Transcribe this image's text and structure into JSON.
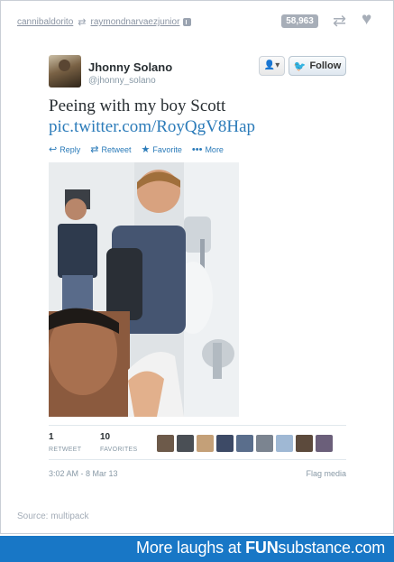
{
  "tumblr": {
    "reblogged_from": "cannibaldorito",
    "reblogged_via": "raymondnarvaezjunior",
    "note_count": "58,963",
    "icons": {
      "reblog_trail": "reblog-icon",
      "reblog": "reblog-icon",
      "like": "heart-icon"
    }
  },
  "tweet": {
    "display_name": "Jhonny Solano",
    "handle": "@jhonny_solano",
    "follow_label": "Follow",
    "text": "Peeing with my boy Scott",
    "link": "pic.twitter.com/RoyQgV8Hap",
    "actions": [
      {
        "label": "Reply",
        "icon": "reply-icon"
      },
      {
        "label": "Retweet",
        "icon": "retweet-icon"
      },
      {
        "label": "Favorite",
        "icon": "star-icon"
      },
      {
        "label": "More",
        "icon": "more-icon"
      }
    ],
    "stats": {
      "retweets": "1",
      "retweets_label": "RETWEET",
      "favorites": "10",
      "favorites_label": "FAVORITES"
    },
    "timestamp": "3:02 AM - 8 Mar 13",
    "flag_label": "Flag media"
  },
  "source": "Source: multipack",
  "banner": {
    "prefix": "More laughs at ",
    "brand_bold": "FUN",
    "brand_rest": "substance.com"
  },
  "colors": {
    "link": "#2b7bb9",
    "banner": "#1877c6",
    "muted": "#8899a6"
  }
}
